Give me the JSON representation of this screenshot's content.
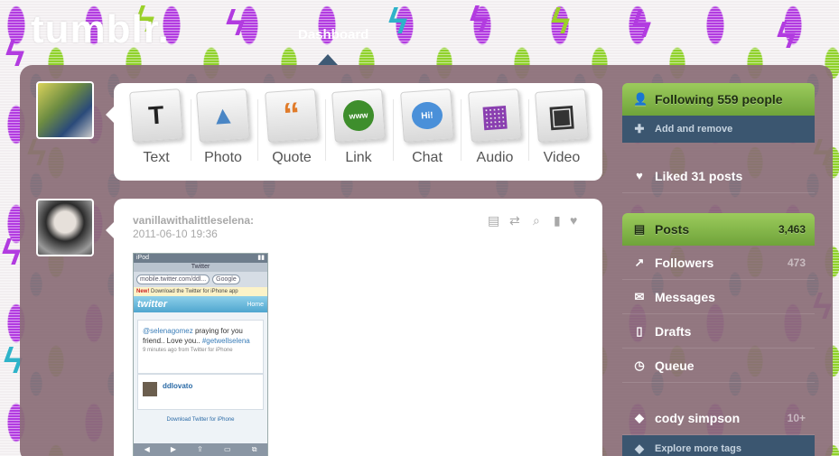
{
  "logo": "tumblr.",
  "nav": {
    "active": "Dashboard"
  },
  "post_types": [
    {
      "label": "Text",
      "glyph": "T",
      "color": "#222222"
    },
    {
      "label": "Photo",
      "glyph": "▲",
      "color": "#4a86c5"
    },
    {
      "label": "Quote",
      "glyph": "“",
      "color": "#e07b2a"
    },
    {
      "label": "Link",
      "glyph": "www",
      "color": "#3e8e2c"
    },
    {
      "label": "Chat",
      "glyph": "Hi!",
      "color": "#4a90d9"
    },
    {
      "label": "Audio",
      "glyph": "▦",
      "color": "#8a3fb0"
    },
    {
      "label": "Video",
      "glyph": "▣",
      "color": "#333333"
    }
  ],
  "post": {
    "username": "vanillawithalittleselena:",
    "date": "2011-06-10 19:36",
    "controls": [
      "note-icon",
      "reblog-icon",
      "search-icon",
      "bookmark-icon",
      "heart-icon"
    ],
    "screenshot": {
      "status_left": "iPod",
      "title": "Twitter",
      "url": "mobile.twitter.com/ddl...",
      "search_placeholder": "Google",
      "banner_new": "New!",
      "banner_text": "Download the Twitter for iPhone app",
      "brand": "twitter",
      "home": "Home",
      "tweet_mention": "@selenagomez",
      "tweet_text": " praying for you friend.. Love you.. ",
      "tweet_tag": "#getwellselena",
      "tweet_meta": "9 minutes ago from Twitter for iPhone",
      "user": "ddlovato",
      "download": "Download Twitter for iPhone"
    }
  },
  "sidebar": {
    "following": {
      "label": "Following 559 people",
      "sub": "Add and remove"
    },
    "liked": "Liked 31 posts",
    "posts": {
      "label": "Posts",
      "count": "3,463"
    },
    "followers": {
      "label": "Followers",
      "count": "473"
    },
    "messages": "Messages",
    "drafts": "Drafts",
    "queue": "Queue",
    "tag": {
      "label": "cody simpson",
      "count": "10+"
    },
    "explore": "Explore more tags"
  },
  "colors": {
    "accent_green": "#7fb447",
    "nav_blue": "#3b5670",
    "panel": "#8a6c76"
  }
}
